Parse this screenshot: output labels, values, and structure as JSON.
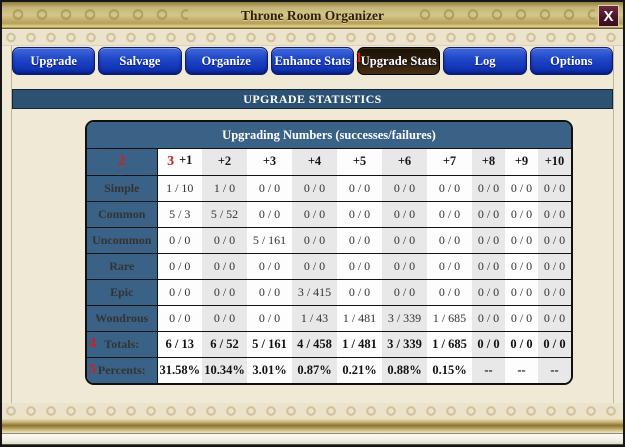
{
  "window": {
    "title": "Throne Room Organizer",
    "close_label": "X"
  },
  "colors": {
    "tab_blue": "#1d45c6",
    "active_tab_brown": "#2d1e0c",
    "table_header_blue": "#3a6287",
    "section_bar_blue": "#2d5173",
    "annotation_red": "#cf1f1f",
    "close_button_maroon": "#4c1526",
    "frame_gold": "#c6b577",
    "background_cream": "#f0e9d6"
  },
  "tabs": [
    {
      "label": "Upgrade",
      "active": false
    },
    {
      "label": "Salvage",
      "active": false
    },
    {
      "label": "Organize",
      "active": false
    },
    {
      "label": "Enhance Stats",
      "active": false
    },
    {
      "label": "Upgrade Stats",
      "active": true,
      "mark": "1"
    },
    {
      "label": "Log",
      "active": false
    },
    {
      "label": "Options",
      "active": false
    }
  ],
  "section_header": "UPGRADE STATISTICS",
  "table": {
    "caption": "Upgrading Numbers (successes/failures)",
    "corner_mark": "2",
    "columns": [
      {
        "label": "+1",
        "mark": "3"
      },
      {
        "label": "+2"
      },
      {
        "label": "+3"
      },
      {
        "label": "+4"
      },
      {
        "label": "+5"
      },
      {
        "label": "+6"
      },
      {
        "label": "+7"
      },
      {
        "label": "+8"
      },
      {
        "label": "+9"
      },
      {
        "label": "+10"
      }
    ],
    "rows": [
      {
        "label": "Simple",
        "values": [
          "1 / 10",
          "1 / 0",
          "0 / 0",
          "0 / 0",
          "0 / 0",
          "0 / 0",
          "0 / 0",
          "0 / 0",
          "0 / 0",
          "0 / 0"
        ]
      },
      {
        "label": "Common",
        "values": [
          "5 / 3",
          "5 / 52",
          "0 / 0",
          "0 / 0",
          "0 / 0",
          "0 / 0",
          "0 / 0",
          "0 / 0",
          "0 / 0",
          "0 / 0"
        ]
      },
      {
        "label": "Uncommon",
        "values": [
          "0 / 0",
          "0 / 0",
          "5 / 161",
          "0 / 0",
          "0 / 0",
          "0 / 0",
          "0 / 0",
          "0 / 0",
          "0 / 0",
          "0 / 0"
        ]
      },
      {
        "label": "Rare",
        "values": [
          "0 / 0",
          "0 / 0",
          "0 / 0",
          "0 / 0",
          "0 / 0",
          "0 / 0",
          "0 / 0",
          "0 / 0",
          "0 / 0",
          "0 / 0"
        ]
      },
      {
        "label": "Epic",
        "values": [
          "0 / 0",
          "0 / 0",
          "0 / 0",
          "3 / 415",
          "0 / 0",
          "0 / 0",
          "0 / 0",
          "0 / 0",
          "0 / 0",
          "0 / 0"
        ]
      },
      {
        "label": "Wondrous",
        "values": [
          "0 / 0",
          "0 / 0",
          "0 / 0",
          "1 / 43",
          "1 / 481",
          "3 / 339",
          "1 / 685",
          "0 / 0",
          "0 / 0",
          "0 / 0"
        ]
      }
    ],
    "summary_rows": [
      {
        "label": "Totals:",
        "mark": "4",
        "values": [
          "6 / 13",
          "6 / 52",
          "5 / 161",
          "4 / 458",
          "1 / 481",
          "3 / 339",
          "1 / 685",
          "0 / 0",
          "0 / 0",
          "0 / 0"
        ]
      },
      {
        "label": "Percents:",
        "mark": "5",
        "values": [
          "31.58%",
          "10.34%",
          "3.01%",
          "0.87%",
          "0.21%",
          "0.88%",
          "0.15%",
          "--",
          "--",
          "--"
        ]
      }
    ]
  }
}
